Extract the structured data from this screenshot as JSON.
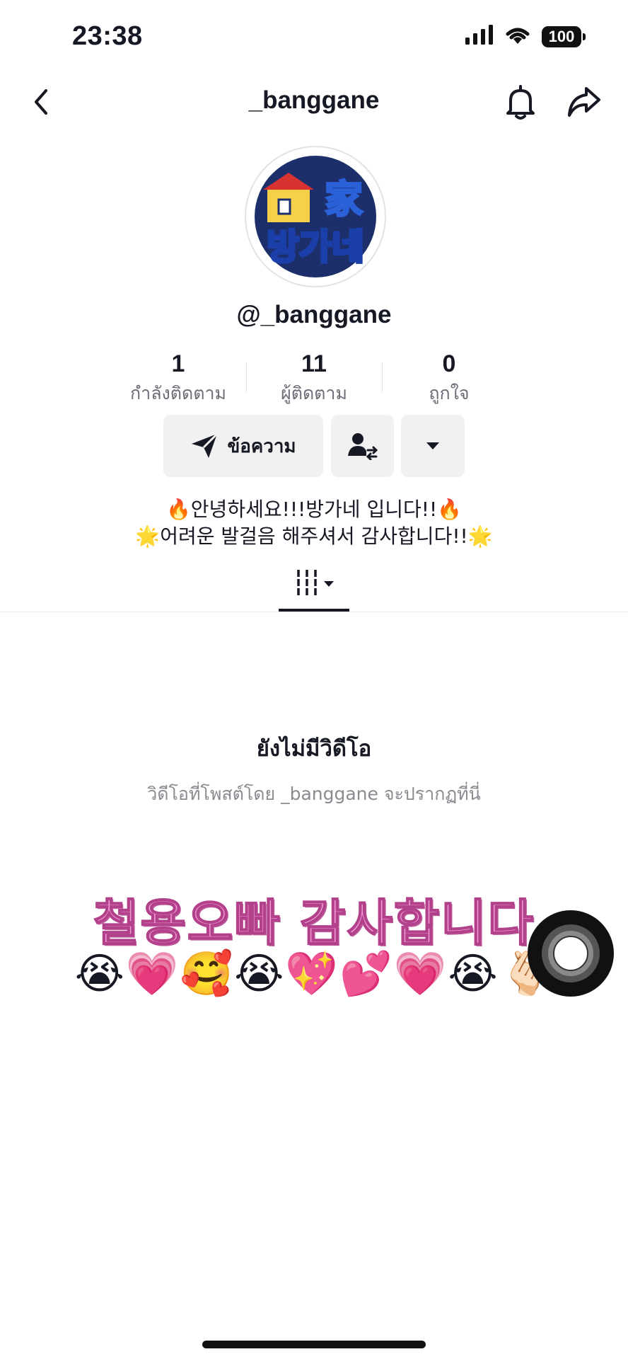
{
  "status_bar": {
    "time": "23:38",
    "battery": "100"
  },
  "header": {
    "title": "_banggane"
  },
  "profile": {
    "avatar_text_top": "家",
    "avatar_text_bottom": "방가네",
    "handle": "@_banggane"
  },
  "stats": [
    {
      "value": "1",
      "label": "กำลังติดตาม"
    },
    {
      "value": "11",
      "label": "ผู้ติดตาม"
    },
    {
      "value": "0",
      "label": "ถูกใจ"
    }
  ],
  "actions": {
    "message_label": "ข้อความ"
  },
  "bio": {
    "line1": "🔥안녕하세요!!!방가네 입니다!!🔥",
    "line2": "🌟어려운 발걸음 해주셔서 감사합니다!!🌟"
  },
  "empty_state": {
    "title": "ยังไม่มีวิดีโอ",
    "subtitle": "วิดีโอที่โพสต์โดย _banggane จะปรากฏที่นี่"
  },
  "overlay": {
    "caption": "철용오빠 감사합니다",
    "emoji_line": "😭💗🥰😭💖💕💗😭🫰🏻"
  },
  "colors": {
    "accent_pink": "#f29ad4",
    "text_primary": "#161823",
    "text_secondary": "#6b6e76",
    "button_bg": "#f1f1f2"
  }
}
